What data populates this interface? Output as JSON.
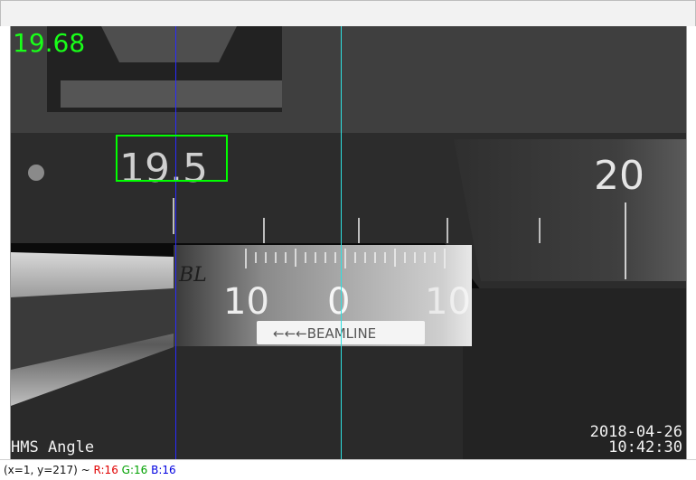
{
  "window": {
    "title": ""
  },
  "overlay": {
    "angle_value": "19.68",
    "roi_label": "19.5"
  },
  "scene": {
    "scale_major_left": "10",
    "scale_major_center": "0",
    "scale_major_right": "10",
    "label_twenty": "20",
    "handwritten": "BL",
    "beamline_label": "←←←BEAMLINE"
  },
  "osd": {
    "camera_name": "HMS Angle",
    "date": "2018-04-26",
    "time": "10:42:30"
  },
  "status": {
    "coords": "(x=1, y=217) ~",
    "r": "R:16",
    "g": "G:16",
    "b": "B:16"
  },
  "colors": {
    "roi_box": "#00ff00",
    "blue_cursor": "#2a2aff",
    "cyan_cursor": "#2ee0e0"
  }
}
